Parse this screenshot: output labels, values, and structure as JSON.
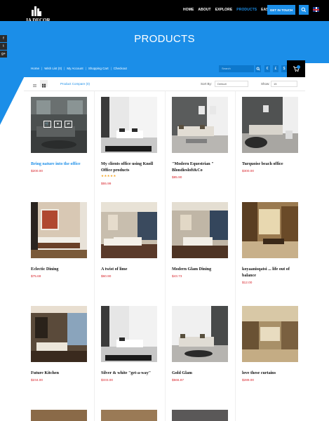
{
  "brand": {
    "name": "JA DECOR"
  },
  "nav": {
    "items": [
      "HOME",
      "ABOUT",
      "EXPLORE",
      "PRODUCTS",
      "EASYBLOG"
    ],
    "active": "PRODUCTS"
  },
  "header": {
    "cta_label": "GET IN TOUCH"
  },
  "hero": {
    "title": "PRODUCTS"
  },
  "social": [
    "f",
    "t",
    "g+"
  ],
  "breadcrumb": {
    "items": [
      "Home",
      "Wish List (0)",
      "My Account",
      "Shopping Cart",
      "Checkout"
    ],
    "separator": "|"
  },
  "search": {
    "placeholder": "Search"
  },
  "toolbar": {
    "compare_label": "Product Compare (0)",
    "sort_label": "Sort By:",
    "sort_value": "Default",
    "show_label": "Show:",
    "show_value": "15"
  },
  "colors": {
    "accent": "#1b8ee8",
    "price": "#d8252c",
    "dark": "#000000"
  },
  "products": [
    {
      "name": "Bring nature into the office",
      "price": "$200.00",
      "highlight": true
    },
    {
      "name": "My clients office using Knoll Office products",
      "price": "$55.99",
      "rating": "★★★★★"
    },
    {
      "name": "\"Modern Equestrian \" Blondiesloft&Co",
      "price": "$85.90"
    },
    {
      "name": "Turquoise beach office",
      "price": "$300.00"
    },
    {
      "name": "Eclectic Dining",
      "price": "$75.69"
    },
    {
      "name": "A twist of lime",
      "price": "$60.90"
    },
    {
      "name": "Modern Glam Dining",
      "price": "$43.73"
    },
    {
      "name": "koyaanisqatsi ... life out of balance",
      "price": "$12.00"
    },
    {
      "name": "Future Kitchen",
      "price": "$234.00"
    },
    {
      "name": "Silver & white \"get-a-way\"",
      "price": "$333.00"
    },
    {
      "name": "Gold Glam",
      "price": "$566.87"
    },
    {
      "name": "love these curtains",
      "price": "$289.00"
    }
  ]
}
